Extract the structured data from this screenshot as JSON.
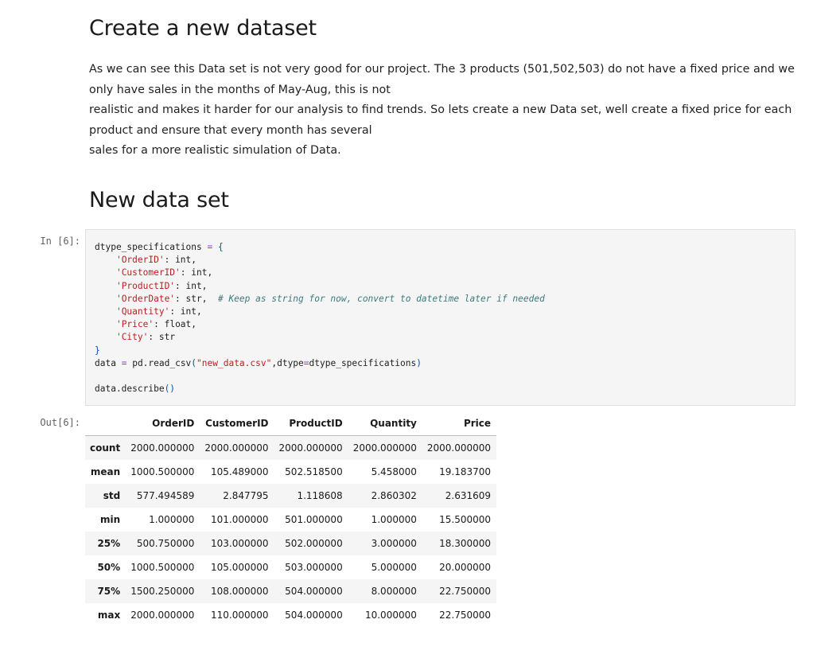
{
  "heading_create": "Create a new dataset",
  "intro_lines": [
    "As we can see this Data set is not very good for our project. The 3 products (501,502,503) do not have a fixed price and we",
    "only have sales in the months of May-Aug, this is not",
    "realistic and makes it harder for our analysis to find trends. So lets create a new Data set, well create a fixed price for each",
    "product and ensure that every month has several",
    "sales for a more realistic simulation of Data."
  ],
  "heading_new": "New data set",
  "code_cell": {
    "in_prompt": "In [6]:",
    "out_prompt": "Out[6]:",
    "var_name": "dtype_specifications",
    "entries": [
      {
        "key": "'OrderID'",
        "type": "int",
        "comment": ""
      },
      {
        "key": "'CustomerID'",
        "type": "int",
        "comment": ""
      },
      {
        "key": "'ProductID'",
        "type": "int",
        "comment": ""
      },
      {
        "key": "'OrderDate'",
        "type": "str",
        "comment": "# Keep as string for now, convert to datetime later if needed"
      },
      {
        "key": "'Quantity'",
        "type": "int",
        "comment": ""
      },
      {
        "key": "'Price'",
        "type": "float",
        "comment": ""
      },
      {
        "key": "'City'",
        "type": "str",
        "comment": ""
      }
    ],
    "read_lhs": "data",
    "read_func": "pd.read_csv",
    "read_arg": "\"new_data.csv\"",
    "read_kw": "dtype",
    "read_kw_val": "dtype_specifications",
    "describe_call": "data.describe"
  },
  "describe_table": {
    "columns": [
      "OrderID",
      "CustomerID",
      "ProductID",
      "Quantity",
      "Price"
    ],
    "rows": [
      {
        "label": "count",
        "values": [
          "2000.000000",
          "2000.000000",
          "2000.000000",
          "2000.000000",
          "2000.000000"
        ]
      },
      {
        "label": "mean",
        "values": [
          "1000.500000",
          "105.489000",
          "502.518500",
          "5.458000",
          "19.183700"
        ]
      },
      {
        "label": "std",
        "values": [
          "577.494589",
          "2.847795",
          "1.118608",
          "2.860302",
          "2.631609"
        ]
      },
      {
        "label": "min",
        "values": [
          "1.000000",
          "101.000000",
          "501.000000",
          "1.000000",
          "15.500000"
        ]
      },
      {
        "label": "25%",
        "values": [
          "500.750000",
          "103.000000",
          "502.000000",
          "3.000000",
          "18.300000"
        ]
      },
      {
        "label": "50%",
        "values": [
          "1000.500000",
          "105.000000",
          "503.000000",
          "5.000000",
          "20.000000"
        ]
      },
      {
        "label": "75%",
        "values": [
          "1500.250000",
          "108.000000",
          "504.000000",
          "8.000000",
          "22.750000"
        ]
      },
      {
        "label": "max",
        "values": [
          "2000.000000",
          "110.000000",
          "504.000000",
          "10.000000",
          "22.750000"
        ]
      }
    ]
  }
}
